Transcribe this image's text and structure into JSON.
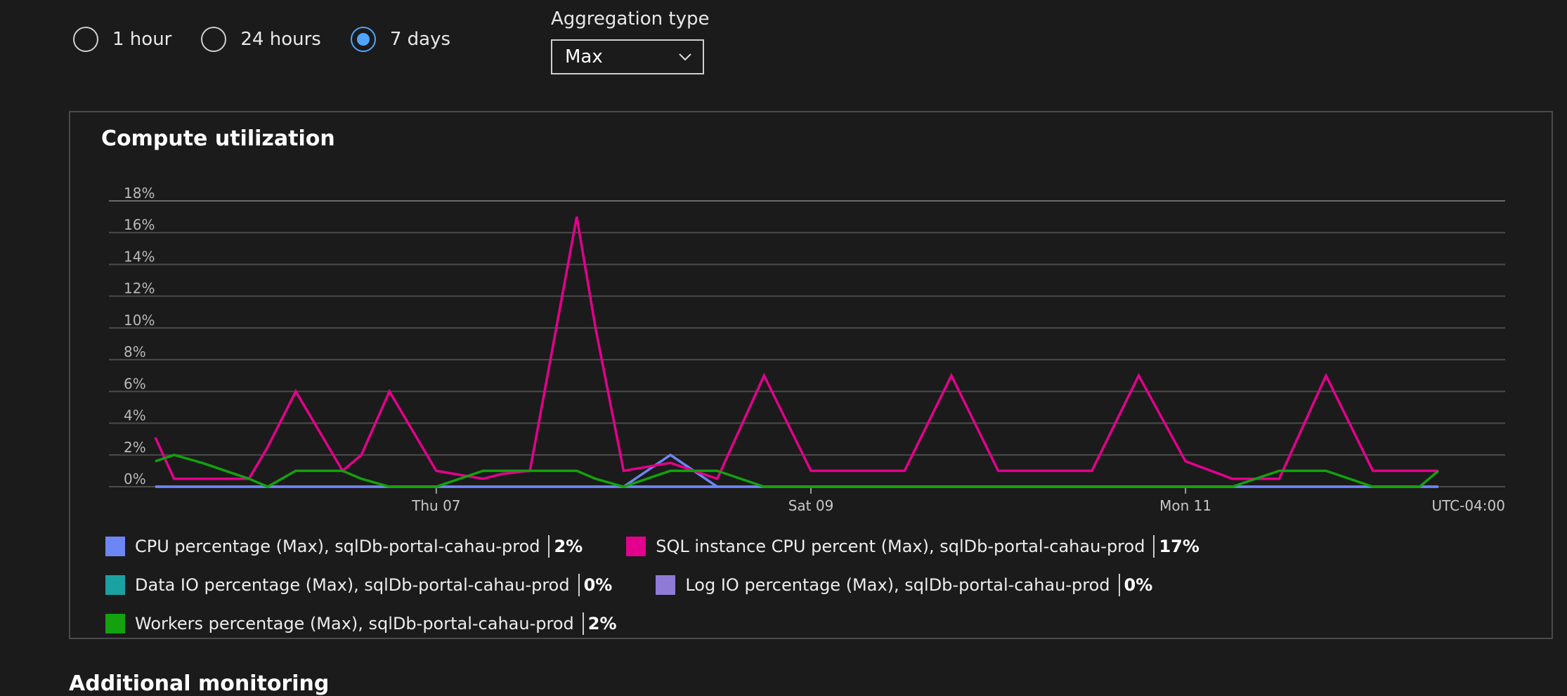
{
  "time_range": {
    "options": [
      {
        "label": "1 hour",
        "selected": false
      },
      {
        "label": "24 hours",
        "selected": false
      },
      {
        "label": "7 days",
        "selected": true
      }
    ]
  },
  "aggregation": {
    "label": "Aggregation type",
    "value": "Max"
  },
  "chart_title": "Compute utilization",
  "colors": {
    "cpu": "#6d86f5",
    "sql": "#e3008c",
    "data_io": "#1ba1a1",
    "log_io": "#8f7ad6",
    "workers": "#13a10e"
  },
  "legend": [
    {
      "name": "CPU percentage (Max), sqlDb-portal-cahau-prod",
      "value": "2%",
      "color": "#6d86f5"
    },
    {
      "name": "SQL instance CPU percent (Max), sqlDb-portal-cahau-prod",
      "value": "17%",
      "color": "#e3008c"
    },
    {
      "name": "Data IO percentage (Max), sqlDb-portal-cahau-prod",
      "value": "0%",
      "color": "#1ba1a1"
    },
    {
      "name": "Log IO percentage (Max), sqlDb-portal-cahau-prod",
      "value": "0%",
      "color": "#8f7ad6"
    },
    {
      "name": "Workers percentage (Max), sqlDb-portal-cahau-prod",
      "value": "2%",
      "color": "#13a10e"
    }
  ],
  "chart_data": {
    "type": "line",
    "title": "Compute utilization",
    "y_ticks": [
      "0%",
      "2%",
      "4%",
      "6%",
      "8%",
      "10%",
      "12%",
      "14%",
      "16%",
      "18%"
    ],
    "ylim": [
      0,
      18
    ],
    "x_tick_labels": [
      "Thu 07",
      "Sat 09",
      "Mon 11"
    ],
    "x_tick_positions": [
      6,
      14,
      22
    ],
    "timezone_label": "UTC-04:00",
    "grid": true,
    "x": [
      0,
      0.4,
      1,
      2,
      2.4,
      3,
      4,
      4.4,
      5,
      6,
      7,
      7.4,
      8,
      9,
      9.4,
      10,
      11,
      12,
      13,
      14,
      15,
      16,
      17,
      18,
      19,
      20,
      21,
      22,
      23,
      24,
      25,
      26,
      27,
      27.4
    ],
    "series": [
      {
        "name": "SQL instance CPU percent (Max), sqlDb-portal-cahau-prod",
        "color": "#e3008c",
        "values": [
          3.1,
          0.5,
          0.5,
          0.5,
          2.5,
          6,
          1,
          2,
          6,
          1,
          0.5,
          0.8,
          1,
          17,
          10,
          1,
          1.5,
          0.5,
          7,
          1,
          1,
          1,
          7,
          1,
          1,
          1,
          7,
          1.6,
          0.5,
          0.5,
          7,
          1,
          1,
          1
        ]
      },
      {
        "name": "CPU percentage (Max), sqlDb-portal-cahau-prod",
        "color": "#6d86f5",
        "values": [
          0,
          0,
          0,
          0,
          0,
          0,
          0,
          0,
          0,
          0,
          0,
          0,
          0,
          0,
          0,
          0,
          0,
          0,
          0,
          0,
          0,
          0,
          0,
          0,
          0,
          0,
          0,
          0,
          0,
          0,
          0,
          0,
          0,
          0
        ]
      },
      {
        "name": "Workers percentage (Max), sqlDb-portal-cahau-prod",
        "color": "#13a10e",
        "values": [
          1.6,
          2,
          1.5,
          0.5,
          0,
          1,
          1,
          0.5,
          0,
          0,
          1,
          1,
          1,
          1,
          0.5,
          0,
          1,
          1,
          0,
          0,
          0,
          0,
          0,
          0,
          0,
          0,
          0,
          0,
          0,
          1,
          1,
          0,
          0,
          1
        ]
      }
    ],
    "cpu_spike": {
      "x": [
        10,
        11,
        12
      ],
      "values": [
        0,
        2,
        0
      ]
    }
  },
  "additional_heading": "Additional monitoring"
}
